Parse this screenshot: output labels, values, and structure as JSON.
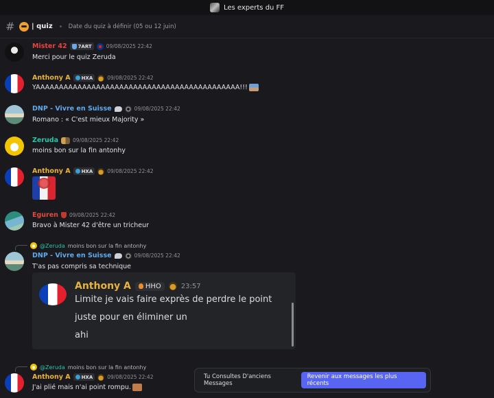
{
  "window": {
    "server_title": "Les experts du FF"
  },
  "channel": {
    "name": "| quiz",
    "topic": "Date du quiz à définir (05 ou 12 juin)"
  },
  "messages": [
    {
      "author": "Mister 42",
      "tag": "7ART",
      "timestamp": "09/08/2025 22:42",
      "text": "Merci pour le quiz Zeruda"
    },
    {
      "author": "Anthony A",
      "tag": "HXA",
      "timestamp": "09/08/2025 22:42",
      "text": "YAAAAAAAAAAAAAAAAAAAAAAAAAAAAAAAAAAAAAAAAAAAA!!!"
    },
    {
      "author": "DNP - Vivre en Suisse",
      "timestamp": "09/08/2025 22:42",
      "text": "Romano : « C'est mieux Majority »"
    },
    {
      "author": "Zeruda",
      "timestamp": "09/08/2025 22:42",
      "text": "moins bon sur la fin antonhy"
    },
    {
      "author": "Anthony A",
      "tag": "HXA",
      "timestamp": "09/08/2025 22:42",
      "text": ""
    },
    {
      "author": "Eguren",
      "timestamp": "09/08/2025 22:42",
      "text": "Bravo à Mister 42 d'être un tricheur"
    },
    {
      "reply": {
        "mention": "@Zeruda",
        "text": "moins bon sur la fin antonhy"
      },
      "author": "DNP - Vivre en Suisse",
      "timestamp": "09/08/2025 22:42",
      "text": "T'as pas compris sa technique"
    },
    {
      "reply": {
        "mention": "@Zeruda",
        "text": "moins bon sur la fin antonhy"
      },
      "author": "Anthony A",
      "tag": "HXA",
      "timestamp": "09/08/2025 22:42",
      "text": "J'ai plié mais n'ai point rompu."
    }
  ],
  "embed": {
    "author": "Anthony A",
    "tag": "HHO",
    "time": "23:57",
    "lines": [
      "Limite je vais faire exprès de perdre le point",
      "juste pour en éliminer un",
      "ahi"
    ]
  },
  "banner": {
    "text": "Tu Consultes D'anciens Messages",
    "button": "Revenir aux messages les plus récents"
  },
  "colors": {
    "accent": "#5865f2",
    "background": "#1a1a1e",
    "name_gold": "#e8b33a",
    "name_red": "#e8433f",
    "name_blue": "#5fa9ec",
    "name_teal": "#26c6a9"
  },
  "icons": [
    "hash-icon",
    "shield-icon",
    "psg-icon",
    "medal-icon",
    "chat-bubble-icon",
    "disc-icon",
    "people-icon",
    "crest-icon",
    "fire-icon"
  ]
}
